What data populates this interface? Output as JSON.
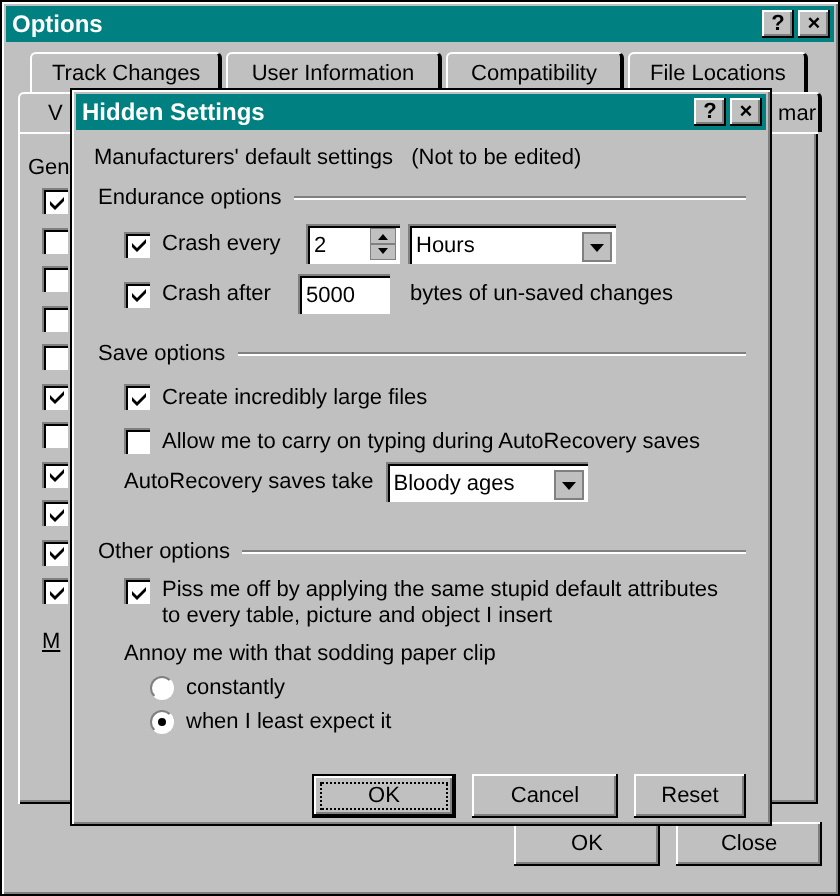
{
  "window": {
    "title": "Options",
    "help_button": "?",
    "close_button": "×"
  },
  "tabs_row_1": [
    {
      "label": "Track Changes"
    },
    {
      "label": "User Information"
    },
    {
      "label": "Compatibility"
    },
    {
      "label": "File Locations"
    }
  ],
  "tabs_row_2": [
    {
      "label": "V"
    },
    {
      "label": "mar"
    }
  ],
  "panel": {
    "group_label": "Gen",
    "checkboxes": [
      {
        "checked": true
      },
      {
        "checked": false
      },
      {
        "checked": false
      },
      {
        "checked": false
      },
      {
        "checked": false
      },
      {
        "checked": true
      },
      {
        "checked": false
      },
      {
        "checked": true
      },
      {
        "checked": true
      },
      {
        "checked": true
      },
      {
        "checked": true
      }
    ],
    "footer_label": "M"
  },
  "buttons": [
    {
      "label": "OK",
      "focused": false
    },
    {
      "label": "Close",
      "focused": false
    }
  ],
  "hidden_settings": {
    "title": "Hidden Settings",
    "help_button": "?",
    "close_button": "×",
    "intro": "Manufacturers' default settings   (Not to be edited)",
    "endurance": {
      "label": "Endurance options",
      "crash_every": {
        "label": "Crash every",
        "checked": true,
        "value": "2",
        "unit": "Hours"
      },
      "crash_after": {
        "label": "Crash after",
        "checked": true,
        "value": "5000",
        "suffix": "bytes of un-saved changes"
      }
    },
    "save": {
      "label": "Save options",
      "options": [
        {
          "label": "Create incredibly large files",
          "checked": true
        },
        {
          "label": "Allow me to carry on typing during AutoRecovery saves",
          "checked": false
        }
      ],
      "autorecovery": {
        "label": "AutoRecovery saves take",
        "value": "Bloody ages"
      }
    },
    "other": {
      "label": "Other options",
      "option": {
        "label": "Piss me off by applying the same stupid default attributes to every table, picture and object I insert",
        "checked": true
      },
      "radio_label": "Annoy me with that sodding paper clip",
      "radios": [
        {
          "label": "constantly",
          "selected": false
        },
        {
          "label": "when I least expect it",
          "selected": true
        }
      ]
    },
    "buttons": [
      {
        "label": "OK",
        "focused": true
      },
      {
        "label": "Cancel",
        "focused": false
      },
      {
        "label": "Reset",
        "focused": false
      }
    ]
  }
}
